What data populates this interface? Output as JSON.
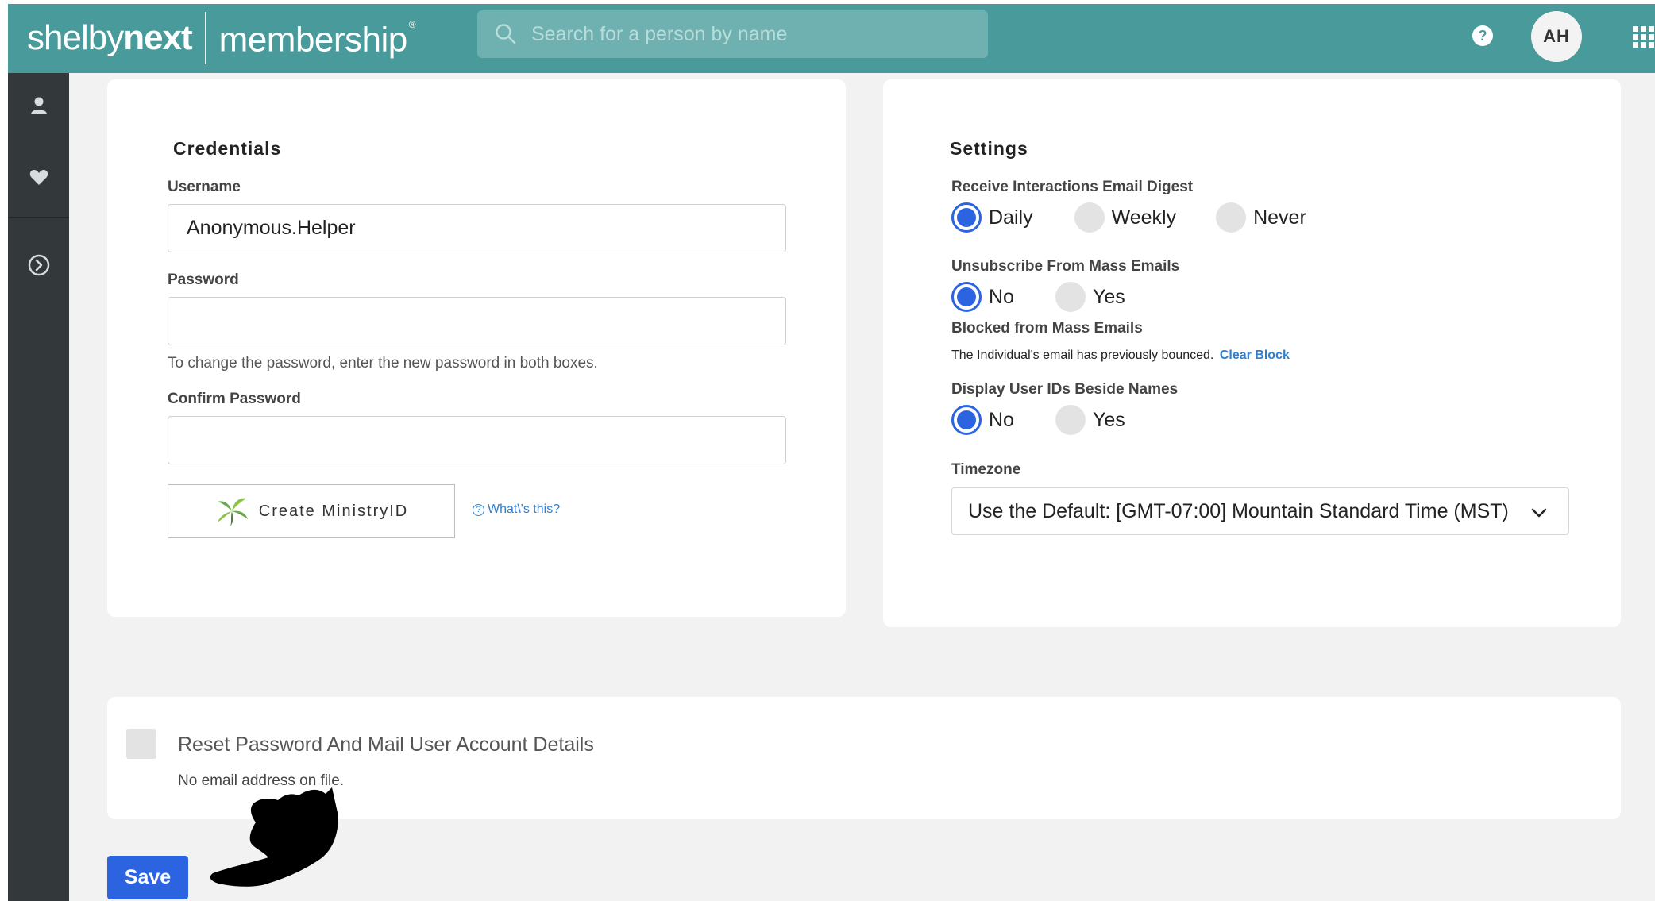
{
  "topbar": {
    "brand_light": "shelby",
    "brand_bold": "next",
    "product": "membership",
    "registered": "®",
    "search_placeholder": "Search for a person by name",
    "avatar_initials": "AH"
  },
  "credentials": {
    "title": "Credentials",
    "username_label": "Username",
    "username_value": "Anonymous.Helper",
    "password_label": "Password",
    "password_value": "",
    "password_help": "To change the password, enter the new password in both boxes.",
    "confirm_label": "Confirm Password",
    "confirm_value": "",
    "ministry_button": "Create MinistryID",
    "whats_this": "What\\'s this?"
  },
  "settings": {
    "title": "Settings",
    "digest_label": "Receive Interactions Email Digest",
    "digest_options": [
      "Daily",
      "Weekly",
      "Never"
    ],
    "digest_selected": "Daily",
    "unsubscribe_label": "Unsubscribe From Mass Emails",
    "unsubscribe_options": [
      "No",
      "Yes"
    ],
    "unsubscribe_selected": "No",
    "blocked_label": "Blocked from Mass Emails",
    "blocked_text": "The Individual's email has previously bounced.",
    "clear_block": "Clear Block",
    "userids_label": "Display User IDs Beside Names",
    "userids_options": [
      "No",
      "Yes"
    ],
    "userids_selected": "No",
    "timezone_label": "Timezone",
    "timezone_value": "Use the Default: [GMT-07:00] Mountain Standard Time (MST)"
  },
  "reset": {
    "checkbox_label": "Reset Password And Mail User Account Details",
    "checked": false,
    "note": "No email address on file."
  },
  "actions": {
    "save_label": "Save"
  },
  "colors": {
    "topbar": "#489b9a",
    "rail": "#33393b",
    "accent": "#2b63e0",
    "link": "#2f7fd0"
  },
  "icons": {
    "rail": [
      "person-icon",
      "heart-icon",
      "expand-circle-icon"
    ],
    "topbar": [
      "search-icon",
      "help-icon",
      "apps-grid-icon"
    ]
  }
}
